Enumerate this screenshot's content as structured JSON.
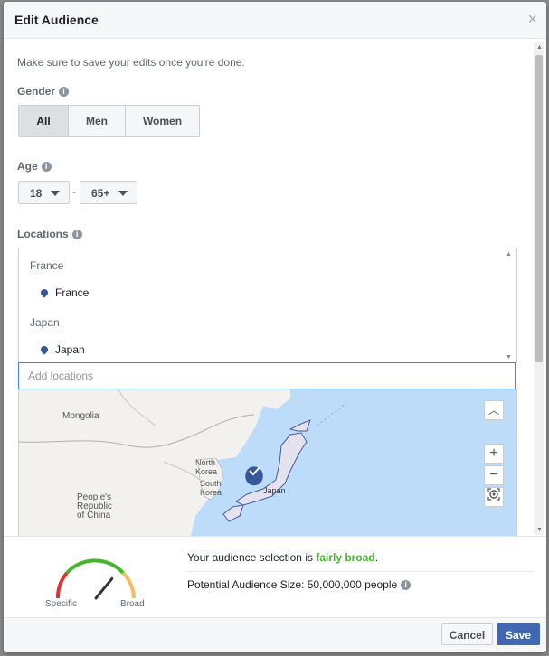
{
  "dialog": {
    "title": "Edit Audience",
    "close_glyph": "×",
    "note": "Make sure to save your edits once you're done."
  },
  "gender": {
    "label": "Gender",
    "options": [
      "All",
      "Men",
      "Women"
    ],
    "selected": "All"
  },
  "age": {
    "label": "Age",
    "min": "18",
    "separator": "-",
    "max": "65+"
  },
  "locations": {
    "label": "Locations",
    "groups": [
      {
        "header": "France",
        "item": "France"
      },
      {
        "header": "Japan",
        "item": "Japan"
      }
    ],
    "add_placeholder": "Add locations"
  },
  "map": {
    "labels": {
      "mongolia": "Mongolia",
      "north_korea_1": "North",
      "north_korea_2": "Korea",
      "south_korea_1": "South",
      "south_korea_2": "Korea",
      "china_1": "People's",
      "china_2": "Republic",
      "china_3": "of China",
      "japan": "Japan"
    },
    "zoom_in": "+",
    "zoom_out": "−",
    "collapse": "︿"
  },
  "audience": {
    "gauge_left": "Specific",
    "gauge_right": "Broad",
    "gauge_level": 0.72,
    "selection_prefix": "Your audience selection is ",
    "selection_value": "fairly broad",
    "selection_suffix": ".",
    "size_text": "Potential Audience Size: 50,000,000 people"
  },
  "buttons": {
    "cancel": "Cancel",
    "save": "Save"
  },
  "colors": {
    "accent": "#4267b2",
    "broad_green": "#42b72a",
    "map_water": "#bddcf9",
    "pin": "#365899"
  }
}
